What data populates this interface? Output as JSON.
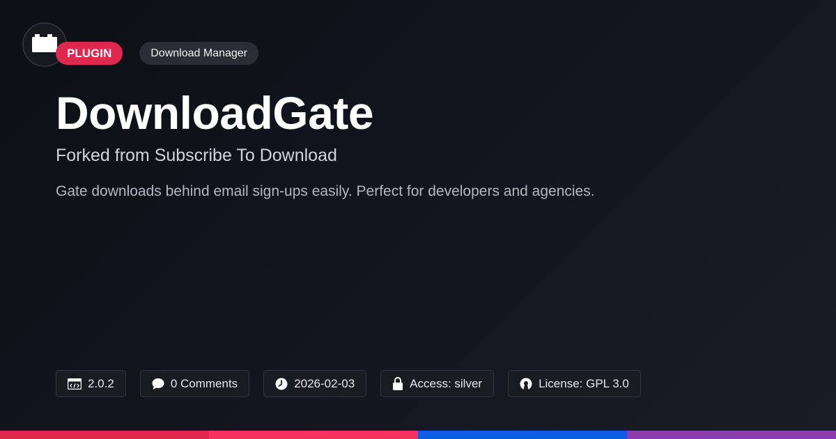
{
  "header": {
    "type_badge": "PLUGIN",
    "category_badge": "Download Manager"
  },
  "plugin": {
    "title": "DownloadGate",
    "subtitle": "Forked from Subscribe To Download",
    "description": "Gate downloads behind email sign-ups easily. Perfect for developers and agencies."
  },
  "meta": {
    "version": "2.0.2",
    "comments": "0 Comments",
    "date": "2026-02-03",
    "access": "Access: silver",
    "license": "License: GPL 3.0"
  },
  "icons": {
    "logo": "plugin-block-icon",
    "version": "code-window-icon",
    "comments": "speech-bubble-icon",
    "date": "clock-icon",
    "access": "lock-icon",
    "license": "open-source-icon"
  },
  "colors": {
    "accent": "#e0284f",
    "bar_segments": [
      "#e0284f",
      "#f3325e",
      "#0a5ee0",
      "#8a3cb0"
    ]
  }
}
